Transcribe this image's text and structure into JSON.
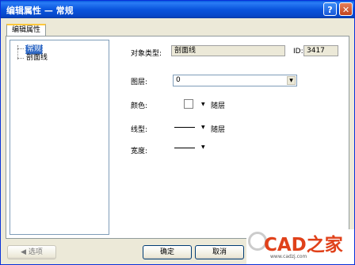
{
  "window": {
    "title": "编辑属性 — 常规",
    "help_label": "?",
    "close_label": "✕"
  },
  "tabs": [
    {
      "label": "编辑属性"
    }
  ],
  "tree": {
    "items": [
      {
        "label": "常规",
        "selected": true
      },
      {
        "label": "剖面线",
        "selected": false
      }
    ]
  },
  "properties": {
    "object_type_label": "对象类型:",
    "object_type_value": "剖面线",
    "id_label": "ID:",
    "id_value": "3417",
    "layer_label": "图层:",
    "layer_value": "0",
    "color_label": "颜色:",
    "color_value": "随层",
    "color_swatch": "#ffffff",
    "linetype_label": "线型:",
    "linetype_value": "随层",
    "width_label": "宽度:"
  },
  "buttons": {
    "options_label": "◀ 选项",
    "ok_label": "确定",
    "cancel_label": "取消"
  },
  "watermark": {
    "logo": "CAD之家",
    "url": "www.cadzj.com"
  },
  "colors": {
    "title_bar": "#0a55dd",
    "selection": "#316ac5",
    "dialog_bg": "#ece9d8",
    "logo": "#e0411a"
  }
}
